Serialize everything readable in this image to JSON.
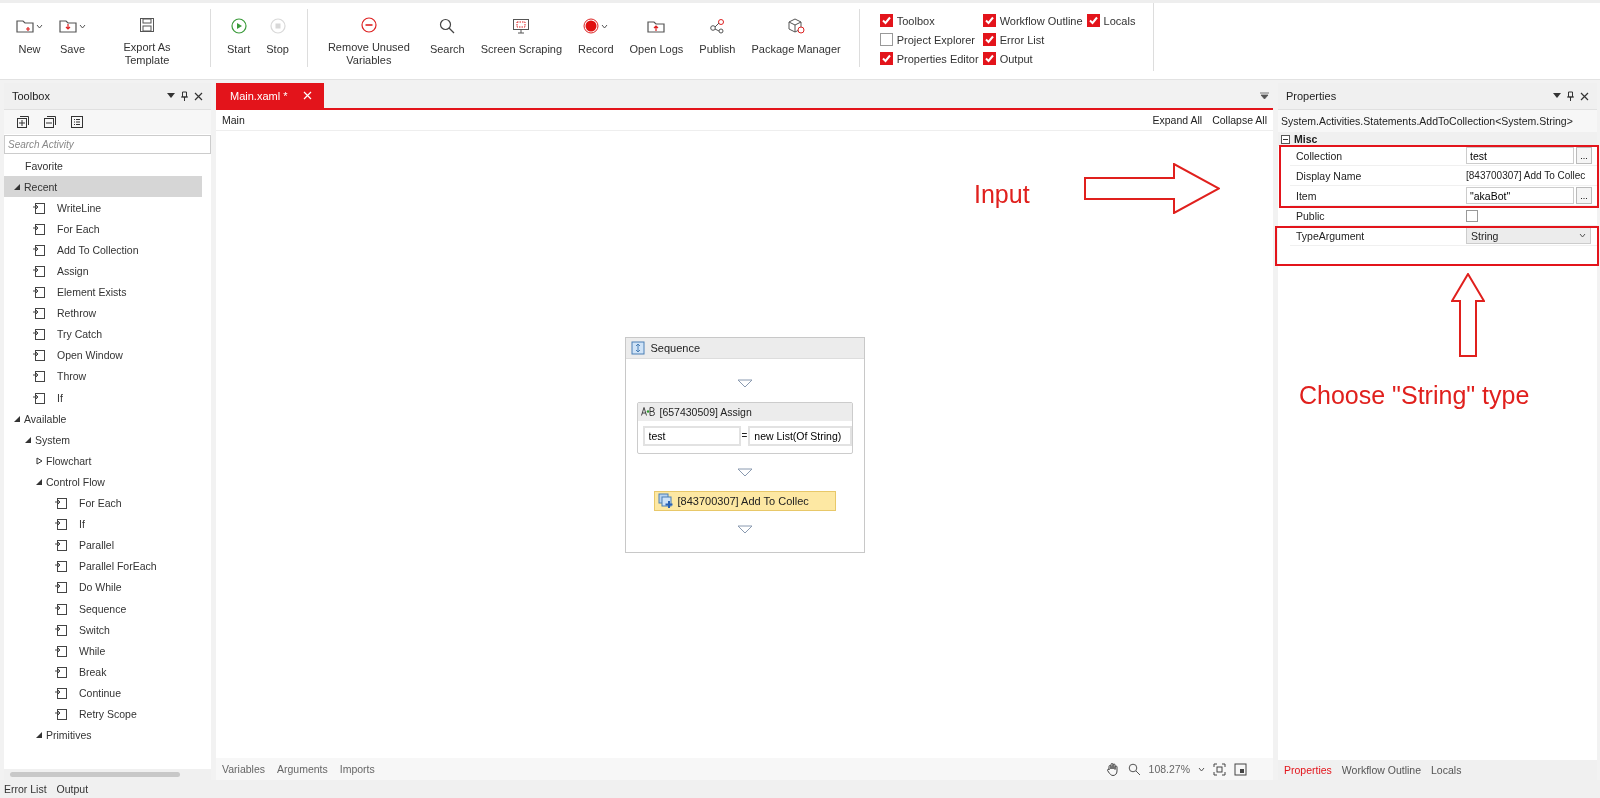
{
  "toolbar": {
    "groups": [
      {
        "buttons": [
          {
            "label": "New",
            "dropdown": true,
            "disabled": false
          },
          {
            "label": "Save",
            "dropdown": true,
            "disabled": false
          },
          {
            "label": "Export As Template",
            "dropdown": false,
            "disabled": false
          }
        ]
      },
      {
        "buttons": [
          {
            "label": "Start",
            "dropdown": false,
            "disabled": false
          },
          {
            "label": "Stop",
            "dropdown": false,
            "disabled": true
          }
        ]
      },
      {
        "buttons": [
          {
            "label": "Remove Unused Variables",
            "dropdown": false,
            "disabled": false
          },
          {
            "label": "Search",
            "dropdown": false,
            "disabled": false
          },
          {
            "label": "Screen Scraping",
            "dropdown": false,
            "disabled": false
          },
          {
            "label": "Record",
            "dropdown": true,
            "disabled": false
          },
          {
            "label": "Open Logs",
            "dropdown": false,
            "disabled": false
          },
          {
            "label": "Publish",
            "dropdown": false,
            "disabled": false
          },
          {
            "label": "Package Manager",
            "dropdown": false,
            "disabled": false
          }
        ]
      }
    ]
  },
  "panels": [
    {
      "label": "Toolbox",
      "checked": true
    },
    {
      "label": "Project Explorer",
      "checked": false
    },
    {
      "label": "Properties Editor",
      "checked": true
    },
    {
      "label": "Workflow Outline",
      "checked": true
    },
    {
      "label": "Error List",
      "checked": true
    },
    {
      "label": "Output",
      "checked": true
    },
    {
      "label": "Locals",
      "checked": true
    }
  ],
  "toolbox": {
    "title": "Toolbox",
    "search": {
      "placeholder": "Search Activity"
    },
    "tree": [
      {
        "kind": "category",
        "label": "Favorite",
        "selected": false
      },
      {
        "kind": "group",
        "label": "Recent",
        "expanded": true,
        "selected": true,
        "children": [
          {
            "kind": "activity",
            "label": "WriteLine",
            "selected": false
          },
          {
            "kind": "activity",
            "label": "For Each",
            "selected": false
          },
          {
            "kind": "activity",
            "label": "Add To Collection",
            "selected": false
          },
          {
            "kind": "activity",
            "label": "Assign",
            "selected": false
          },
          {
            "kind": "activity",
            "label": "Element Exists",
            "selected": false
          },
          {
            "kind": "activity",
            "label": "Rethrow",
            "selected": false
          },
          {
            "kind": "activity",
            "label": "Try Catch",
            "selected": false
          },
          {
            "kind": "activity",
            "label": "Open Window",
            "selected": false
          },
          {
            "kind": "activity",
            "label": "Throw",
            "selected": false
          },
          {
            "kind": "activity",
            "label": "If",
            "selected": false
          }
        ]
      },
      {
        "kind": "group",
        "label": "Available",
        "expanded": true,
        "selected": false,
        "children": [
          {
            "kind": "group",
            "label": "System",
            "expanded": true,
            "selected": false,
            "children": [
              {
                "kind": "group",
                "label": "Flowchart",
                "expanded": false,
                "selected": false
              },
              {
                "kind": "group",
                "label": "Control Flow",
                "expanded": true,
                "selected": false,
                "children": [
                  {
                    "kind": "activity",
                    "label": "For Each",
                    "selected": false
                  },
                  {
                    "kind": "activity",
                    "label": "If",
                    "selected": false
                  },
                  {
                    "kind": "activity",
                    "label": "Parallel",
                    "selected": false
                  },
                  {
                    "kind": "activity",
                    "label": "Parallel ForEach",
                    "selected": false
                  },
                  {
                    "kind": "activity",
                    "label": "Do While",
                    "selected": false
                  },
                  {
                    "kind": "activity",
                    "label": "Sequence",
                    "selected": false
                  },
                  {
                    "kind": "activity",
                    "label": "Switch",
                    "selected": false
                  },
                  {
                    "kind": "activity",
                    "label": "While",
                    "selected": false
                  },
                  {
                    "kind": "activity",
                    "label": "Break",
                    "selected": false
                  },
                  {
                    "kind": "activity",
                    "label": "Continue",
                    "selected": false
                  },
                  {
                    "kind": "activity",
                    "label": "Retry Scope",
                    "selected": false
                  }
                ]
              },
              {
                "kind": "group",
                "label": "Primitives",
                "expanded": true,
                "selected": false
              }
            ]
          }
        ]
      }
    ]
  },
  "editor": {
    "tabs": [
      {
        "label": "Main.xaml *",
        "selected": true
      }
    ],
    "breadcrumb": "Main",
    "actions": [
      "Expand All",
      "Collapse All"
    ],
    "sequence": {
      "title": "Sequence",
      "assign": {
        "title": "[657430509] Assign",
        "to": "test",
        "operator": "=",
        "value": "new List(Of String)"
      },
      "activity": {
        "title": "[843700307] Add To Collec",
        "selected": true
      }
    },
    "footer_tabs": [
      "Variables",
      "Arguments",
      "Imports"
    ],
    "zoom": "108.27%"
  },
  "properties": {
    "title": "Properties",
    "type_name": "System.Activities.Statements.AddToCollection<System.String>",
    "category": "Misc",
    "rows": [
      {
        "kind": "text_button",
        "name": "Collection",
        "value": "test",
        "button": "..."
      },
      {
        "kind": "text",
        "name": "Display Name",
        "value": "[843700307] Add To Collec"
      },
      {
        "kind": "text_button",
        "name": "Item",
        "value": "\"akaBot\"",
        "button": "..."
      },
      {
        "kind": "checkbox",
        "name": "Public",
        "checked": false
      },
      {
        "kind": "dropdown",
        "name": "TypeArgument",
        "value": "String"
      }
    ],
    "tabs": [
      {
        "label": "Properties",
        "selected": true
      },
      {
        "label": "Workflow Outline",
        "selected": false
      },
      {
        "label": "Locals",
        "selected": false
      }
    ]
  },
  "bottom_tabs": [
    "Error List",
    "Output"
  ],
  "annotations": [
    {
      "text": "Input"
    },
    {
      "text": "Choose \"String\" type"
    }
  ]
}
